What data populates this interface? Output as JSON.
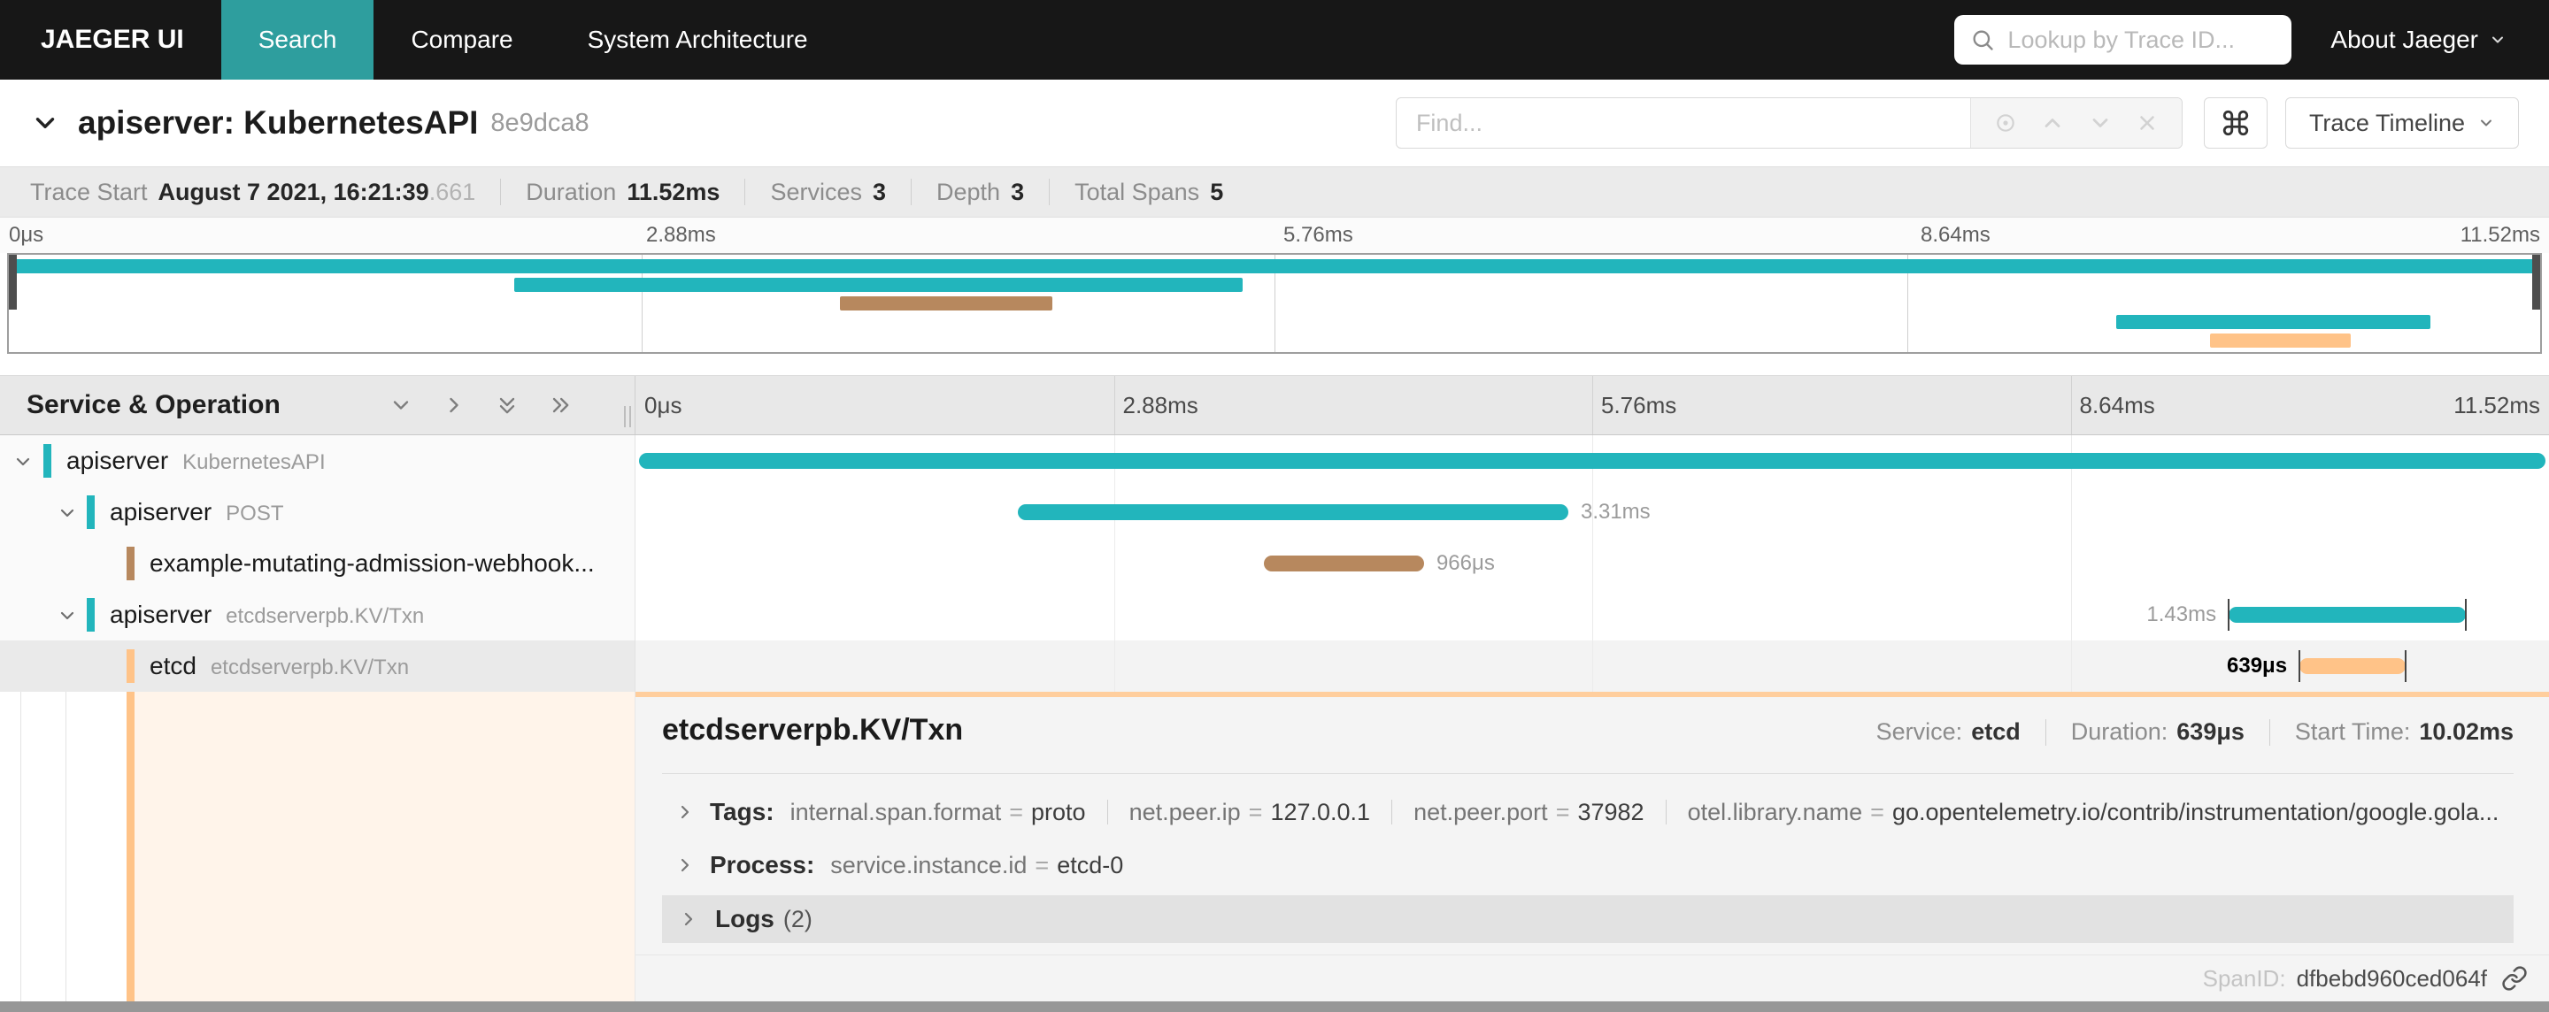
{
  "nav": {
    "brand": "JAEGER UI",
    "tabs": [
      {
        "label": "Search",
        "active": true
      },
      {
        "label": "Compare",
        "active": false
      },
      {
        "label": "System Architecture",
        "active": false
      }
    ],
    "lookup_placeholder": "Lookup by Trace ID...",
    "about_label": "About Jaeger"
  },
  "trace_header": {
    "title": "apiserver: KubernetesAPI",
    "trace_id": "8e9dca8",
    "find_placeholder": "Find...",
    "view_label": "Trace Timeline"
  },
  "summary": {
    "items": [
      {
        "label": "Trace Start",
        "value": "August 7 2021, 16:21:39",
        "suffix": ".661"
      },
      {
        "label": "Duration",
        "value": "11.52ms"
      },
      {
        "label": "Services",
        "value": "3"
      },
      {
        "label": "Depth",
        "value": "3"
      },
      {
        "label": "Total Spans",
        "value": "5"
      }
    ]
  },
  "timeline": {
    "column_header": "Service & Operation",
    "ticks": [
      "0μs",
      "2.88ms",
      "5.76ms",
      "8.64ms",
      "11.52ms"
    ],
    "gridlines_pct": [
      25,
      50,
      75
    ]
  },
  "spans": [
    {
      "service": "apiserver",
      "operation": "KubernetesAPI",
      "depth": 0,
      "color": "#22B5BC",
      "start_pct": 0.2,
      "width_pct": 99.6,
      "duration_label": "",
      "label_side": "none",
      "has_children": true,
      "selected": false,
      "end_ticks": false
    },
    {
      "service": "apiserver",
      "operation": "POST",
      "depth": 1,
      "color": "#22B5BC",
      "start_pct": 19.98,
      "width_pct": 28.77,
      "duration_label": "3.31ms",
      "label_side": "right",
      "has_children": true,
      "selected": false,
      "end_ticks": false
    },
    {
      "service": "example-mutating-admission-webhook...",
      "operation": "",
      "depth": 2,
      "color": "#B7885E",
      "start_pct": 32.84,
      "width_pct": 8.37,
      "duration_label": "966μs",
      "label_side": "right",
      "has_children": false,
      "selected": false,
      "end_ticks": false
    },
    {
      "service": "apiserver",
      "operation": "etcdserverpb.KV/Txn",
      "depth": 1,
      "color": "#22B5BC",
      "start_pct": 83.26,
      "width_pct": 12.4,
      "duration_label": "1.43ms",
      "label_side": "left",
      "has_children": true,
      "selected": false,
      "end_ticks": true
    },
    {
      "service": "etcd",
      "operation": "etcdserverpb.KV/Txn",
      "depth": 2,
      "color": "#FFC388",
      "start_pct": 86.96,
      "width_pct": 5.55,
      "duration_label": "639μs",
      "label_side": "left",
      "has_children": false,
      "selected": true,
      "end_ticks": true
    }
  ],
  "detail": {
    "title": "etcdserverpb.KV/Txn",
    "meta": [
      {
        "label": "Service:",
        "value": "etcd"
      },
      {
        "label": "Duration:",
        "value": "639μs"
      },
      {
        "label": "Start Time:",
        "value": "10.02ms"
      }
    ],
    "tags_label": "Tags:",
    "tags": [
      {
        "key": "internal.span.format",
        "value": "proto"
      },
      {
        "key": "net.peer.ip",
        "value": "127.0.0.1"
      },
      {
        "key": "net.peer.port",
        "value": "37982"
      },
      {
        "key": "otel.library.name",
        "value": "go.opentelemetry.io/contrib/instrumentation/google.gola..."
      }
    ],
    "process_label": "Process:",
    "process": [
      {
        "key": "service.instance.id",
        "value": "etcd-0"
      }
    ],
    "logs_label": "Logs",
    "logs_count": "(2)",
    "spanid_label": "SpanID:",
    "span_id": "dfbebd960ced064f"
  },
  "colors": {
    "teal_span": "#22B5BC",
    "brown_span": "#B7885E",
    "peach_span": "#FFC388",
    "nav_bg": "#171717",
    "active_tab_bg": "#2e9e9e"
  }
}
